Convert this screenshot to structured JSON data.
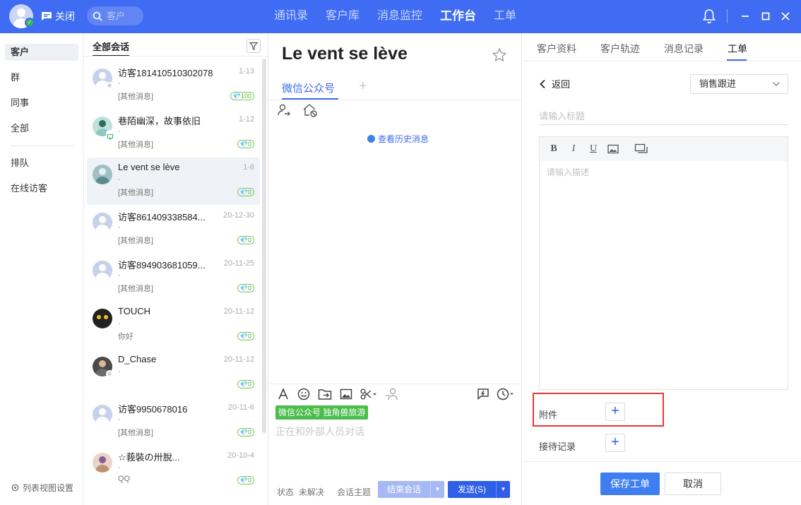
{
  "topbar": {
    "close_label": "关闭",
    "search_placeholder": "客户",
    "nav": [
      "通讯录",
      "客户库",
      "消息监控",
      "工作台",
      "工单"
    ],
    "active_nav": "工作台",
    "accent": "#3f6cf2"
  },
  "sidebar": {
    "items": [
      "客户",
      "群",
      "同事",
      "全部",
      "排队",
      "在线访客"
    ],
    "active": "客户",
    "settings_label": "列表视图设置"
  },
  "conversations": {
    "header": "全部会话",
    "items": [
      {
        "name": "访客181410510302078",
        "date": "1-13",
        "dash": "-",
        "msg": "[其他消息]",
        "badge": "100"
      },
      {
        "name": "巷陌幽深，故事依旧",
        "date": "1-12",
        "dash": "-",
        "msg": "[其他消息]",
        "badge": "0"
      },
      {
        "name": "Le vent se lève",
        "date": "1-6",
        "dash": "-",
        "msg": "[其他消息]",
        "badge": "0"
      },
      {
        "name": "访客861409338584...",
        "date": "20-12-30",
        "dash": "-",
        "msg": "[其他消息]",
        "badge": "0"
      },
      {
        "name": "访客894903681059...",
        "date": "20-11-25",
        "dash": "-",
        "msg": "[其他消息]",
        "badge": "0"
      },
      {
        "name": "TOUCH",
        "date": "20-11-12",
        "dash": "-",
        "msg": "你好",
        "badge": "0"
      },
      {
        "name": "D_Chase",
        "date": "20-11-12",
        "dash": "-",
        "msg": "",
        "badge": "0"
      },
      {
        "name": "访客9950678016",
        "date": "20-11-6",
        "dash": "-",
        "msg": "[其他消息]",
        "badge": "0"
      },
      {
        "name": "☆莪裝の卅脫...",
        "date": "20-10-4",
        "dash": "-",
        "msg": "QQ",
        "badge": "0"
      }
    ]
  },
  "chat": {
    "title": "Le vent se lève",
    "channel_tab": "微信公众号",
    "history_label": "查看历史消息",
    "channel_tag": "微信公众号 独角兽旅游",
    "composer_placeholder": "正在和外部人员对话",
    "status_label": "状态",
    "status_value": "未解决",
    "topic_label": "会话主题",
    "end_button": "结束会话",
    "send_button": "发送(S)"
  },
  "right_panel": {
    "tabs": [
      "客户资料",
      "客户轨迹",
      "消息记录",
      "工单"
    ],
    "active_tab": "工单",
    "back_label": "返回",
    "select_value": "销售跟进",
    "title_placeholder": "请输入标题",
    "desc_placeholder": "请输入描述",
    "attachment_label": "附件",
    "reception_label": "接待记录",
    "save_button": "保存工单",
    "cancel_button": "取消"
  }
}
